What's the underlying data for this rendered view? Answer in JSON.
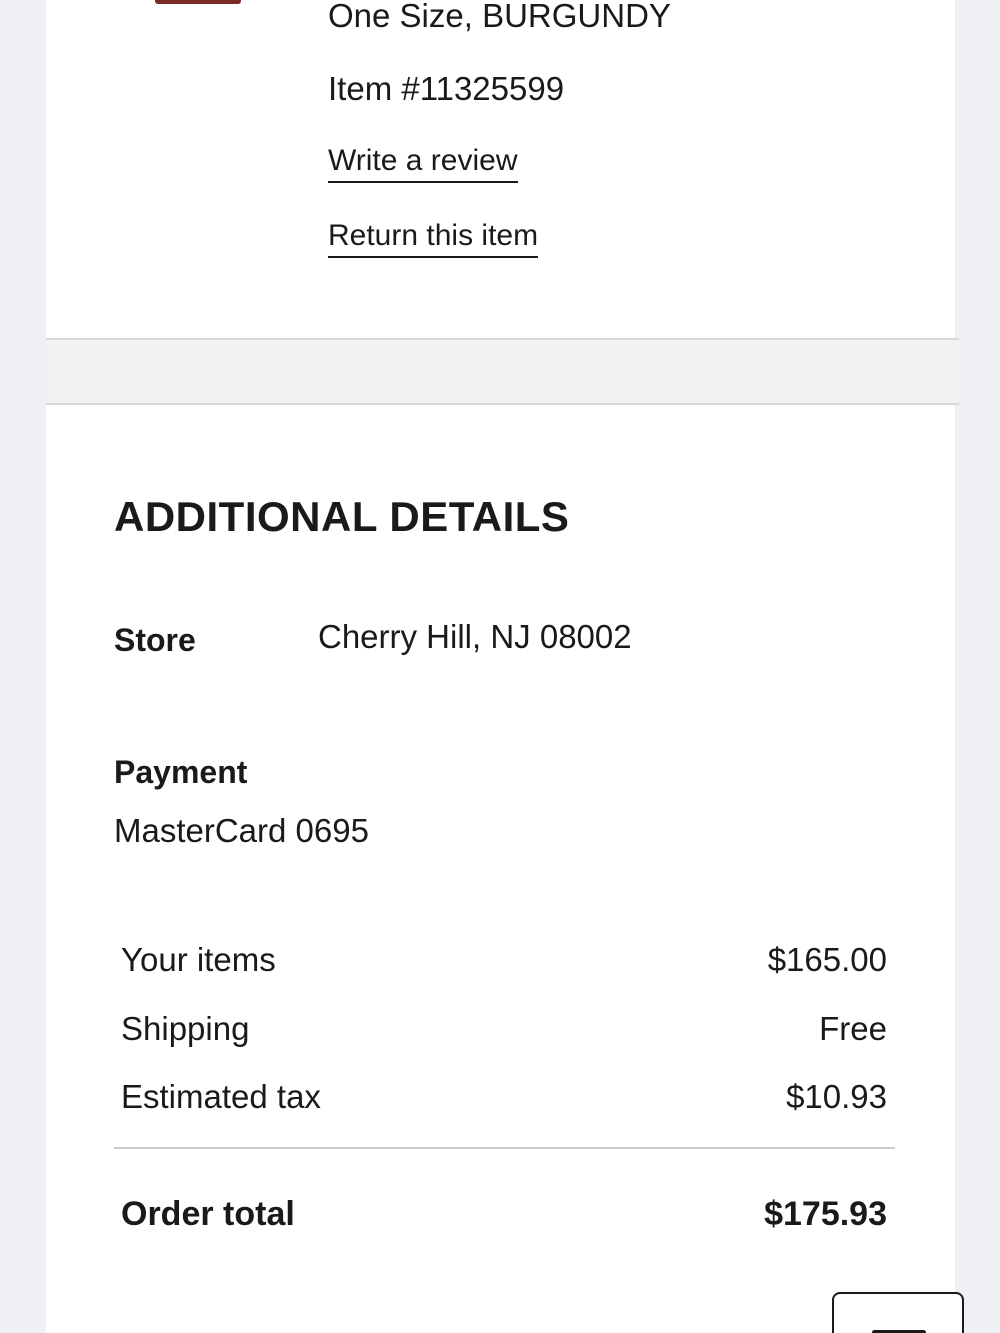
{
  "item": {
    "variant": "One Size, BURGUNDY",
    "item_number": "Item #11325599",
    "write_review_label": "Write a review",
    "return_label": "Return this item",
    "thumbnail_color": "#7a2a26"
  },
  "additional_details": {
    "title": "ADDITIONAL DETAILS",
    "store_label": "Store",
    "store_value": "Cherry Hill, NJ 08002",
    "payment_label": "Payment",
    "payment_value": "MasterCard 0695"
  },
  "summary": {
    "items_label": "Your items",
    "items_value": "$165.00",
    "shipping_label": "Shipping",
    "shipping_value": "Free",
    "tax_label": "Estimated tax",
    "tax_value": "$10.93",
    "total_label": "Order total",
    "total_value": "$175.93"
  },
  "floating_button": {
    "icon": "chat-icon"
  }
}
